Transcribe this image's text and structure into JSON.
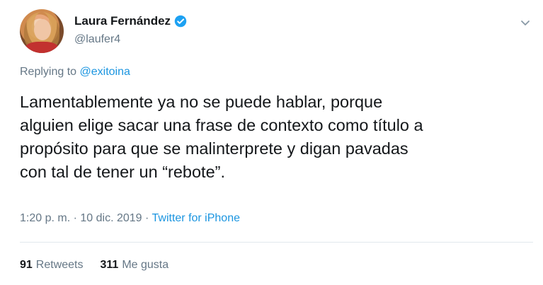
{
  "author": {
    "display_name": "Laura Fernández",
    "handle": "@laufer4",
    "verified": true
  },
  "reply": {
    "prefix": "Replying to ",
    "mention": "@exitoina"
  },
  "tweet": {
    "text": "Lamentablemente ya no se puede hablar, porque\nalguien elige sacar una frase de contexto como título a\npropósito para que se malinterprete y digan pavadas\ncon tal de tener un “rebote”."
  },
  "meta": {
    "time": "1:20 p. m.",
    "separator": " · ",
    "date": "10 dic. 2019",
    "separator2": " · ",
    "source": "Twitter for iPhone"
  },
  "stats": {
    "retweets_count": "91",
    "retweets_label": "Retweets",
    "likes_count": "311",
    "likes_label": "Me gusta"
  },
  "colors": {
    "link": "#1b95e0",
    "secondary_text": "#657786",
    "primary_text": "#14171a",
    "divider": "#e1e8ed"
  },
  "icons": {
    "verified": "verified-badge-icon",
    "menu": "chevron-down-icon"
  }
}
